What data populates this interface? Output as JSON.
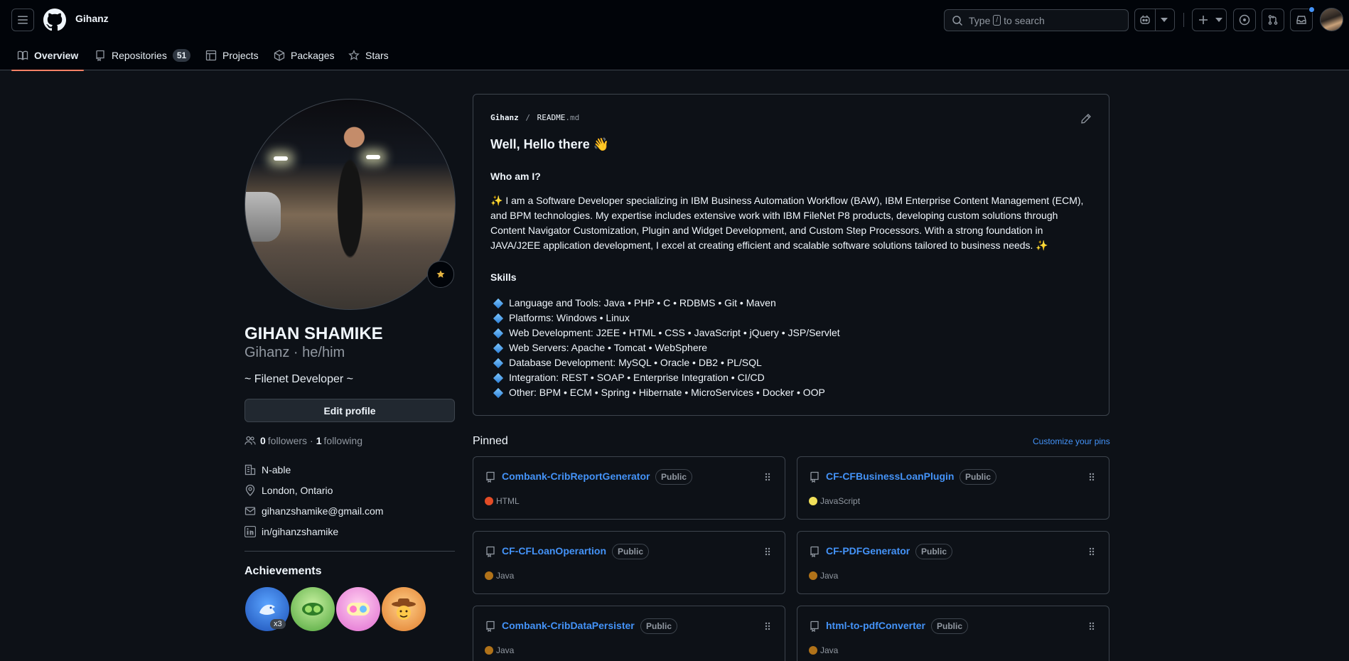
{
  "header": {
    "owner": "Gihanz",
    "search_prefix": "Type",
    "search_key": "/",
    "search_suffix": "to search"
  },
  "tabs": [
    {
      "label": "Overview",
      "icon": "book-icon"
    },
    {
      "label": "Repositories",
      "icon": "repo-icon",
      "count": "51"
    },
    {
      "label": "Projects",
      "icon": "table-icon"
    },
    {
      "label": "Packages",
      "icon": "package-icon"
    },
    {
      "label": "Stars",
      "icon": "star-icon"
    }
  ],
  "profile": {
    "name": "GIHAN SHAMIKE",
    "login_line": "Gihanz · he/him",
    "bio": "~ Filenet Developer ~",
    "edit_label": "Edit profile",
    "followers": "0",
    "followers_label": "followers",
    "dot": "·",
    "following": "1",
    "following_label": "following",
    "details": [
      {
        "icon": "organization-icon",
        "text": "N-able"
      },
      {
        "icon": "location-icon",
        "text": "London, Ontario"
      },
      {
        "icon": "mail-icon",
        "text": "gihanzshamike@gmail.com"
      },
      {
        "icon": "linkedin-icon",
        "text": "in/gihanzshamike"
      }
    ],
    "achievements_title": "Achievements",
    "achievement_count": "x3"
  },
  "readme": {
    "path_user": "Gihanz",
    "path_sep": "/",
    "path_file": "README",
    "path_ext": ".md",
    "heading": "Well, Hello there 👋",
    "who_heading": "Who am I?",
    "about": "✨ I am a Software Developer specializing in IBM Business Automation Workflow (BAW), IBM Enterprise Content Management (ECM), and BPM technologies. My expertise includes extensive work with IBM FileNet P8 products, developing custom solutions through Content Navigator Customization, Plugin and Widget Development, and Custom Step Processors. With a strong foundation in JAVA/J2EE application development, I excel at creating efficient and scalable software solutions tailored to business needs. ✨",
    "skills_heading": "Skills",
    "skills": [
      "Language and Tools: Java • PHP • C • RDBMS • Git • Maven",
      "Platforms: Windows • Linux",
      "Web Development: J2EE • HTML • CSS • JavaScript • jQuery • JSP/Servlet",
      "Web Servers: Apache • Tomcat • WebSphere",
      "Database Development: MySQL • Oracle • DB2 • PL/SQL",
      "Integration: REST • SOAP • Enterprise Integration • CI/CD",
      "Other: BPM • ECM • Spring • Hibernate • MicroServices • Docker • OOP"
    ]
  },
  "pinned": {
    "title": "Pinned",
    "customize_label": "Customize your pins",
    "repos": [
      {
        "name": "Combank-CribReportGenerator",
        "visibility": "Public",
        "language": "HTML",
        "color": "#e34c26"
      },
      {
        "name": "CF-CFBusinessLoanPlugin",
        "visibility": "Public",
        "language": "JavaScript",
        "color": "#f1e05a"
      },
      {
        "name": "CF-CFLoanOperartion",
        "visibility": "Public",
        "language": "Java",
        "color": "#b07219"
      },
      {
        "name": "CF-PDFGenerator",
        "visibility": "Public",
        "language": "Java",
        "color": "#b07219"
      },
      {
        "name": "Combank-CribDataPersister",
        "visibility": "Public",
        "language": "Java",
        "color": "#b07219"
      },
      {
        "name": "html-to-pdfConverter",
        "visibility": "Public",
        "language": "Java",
        "color": "#b07219"
      }
    ]
  }
}
